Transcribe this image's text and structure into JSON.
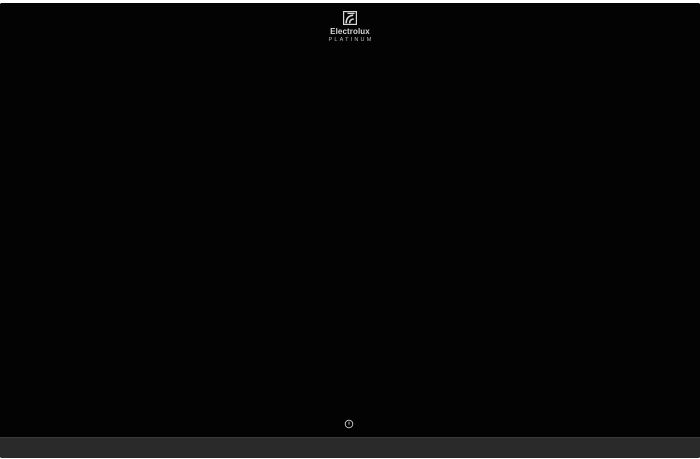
{
  "brand": {
    "name": "Electrolux",
    "line": "PLATINUM",
    "logo_icon": "electrolux-logo-icon"
  },
  "controls": {
    "power_icon": "power-icon"
  },
  "colors": {
    "glass": "#030303",
    "frame": "#2a2a2a",
    "text": "#d8d8d8"
  }
}
